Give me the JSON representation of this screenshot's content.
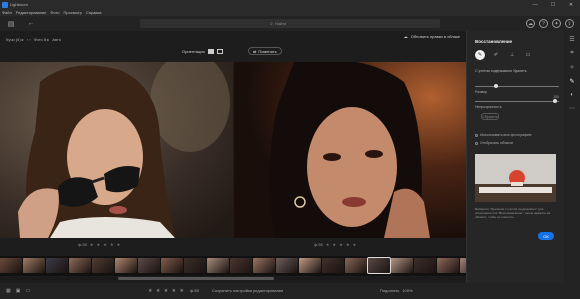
{
  "window": {
    "title": "Lightroom",
    "minimize": "—",
    "maximize": "☐",
    "close": "✕"
  },
  "menu": [
    "Файл",
    "Редактирование",
    "Фото",
    "Просмотр",
    "Справка"
  ],
  "toolbar": {
    "search_placeholder": "Найти"
  },
  "compare": {
    "breadcrumb": [
      "Кучи (6) ▸",
      "‹ ›",
      "Фото 8 ▸",
      "Авто"
    ],
    "cloud_label": "Обновить правки в облаке",
    "orientation_label": "Ориентация",
    "swap_label": "Поменять"
  },
  "photos": {
    "left_footer_label": "ф.55",
    "left_stars": "★ ★ ★ ★ ★",
    "right_footer_label": "ф.55",
    "right_stars": "★ ★ ★ ★ ★"
  },
  "filmstrip_colors": [
    "#6b4a3a",
    "#a07c66",
    "#3b3b46",
    "#8f6b58",
    "#4f3c34",
    "#b08670",
    "#5d4b48",
    "#7f5d4c",
    "#3a2f2a",
    "#a88c7c",
    "#4b3530",
    "#9a7462",
    "#6d5e5a",
    "#c19a84",
    "#40302b",
    "#866656",
    "#5a4a46",
    "#b69584",
    "#3c2e2a",
    "#8e6a5a",
    "#a2847a",
    "#4e3b35",
    "#7c6357",
    "#c4a390",
    "#5b463e",
    "#90705f",
    "#3f2f2b",
    "#b0907e",
    "#6a5048",
    "#9c7a68",
    "#4a3834",
    "#7e5f50",
    "#a78876",
    "#553f38",
    "#8d6c5c",
    "#bb9886",
    "#463430",
    "#7a5a4b",
    "#a48574",
    "#5e4840"
  ],
  "bottombar": {
    "stars": "★ ★ ★ ★ ★",
    "rating_label": "ф.55",
    "save_label": "Сохранить настройки редактирования",
    "zoom_label": "Подогнать",
    "zoom_value": "100%"
  },
  "panel": {
    "title": "Восстановление",
    "mode_label": "С учетом содержимого Удалить",
    "slider1_label": "Размер",
    "slider1_value": "",
    "slider1_fraction": 0.25,
    "slider2_label": "Непрозрачность",
    "slider2_value": "100",
    "slider2_fraction": 0.95,
    "ok_small": "Сбросить",
    "check1": "Использовать всю фотографию",
    "check2": "Отобразить области",
    "hint": "Выберите \"Удаление с учетом содержимого\" для исполнения или \"Восстановление\", затем нажмите на области, чтобы их отметить.",
    "ok_button": "ОК"
  },
  "colors": {
    "accent": "#1473e6",
    "background": "#1d1d1d",
    "panel": "#262626"
  }
}
